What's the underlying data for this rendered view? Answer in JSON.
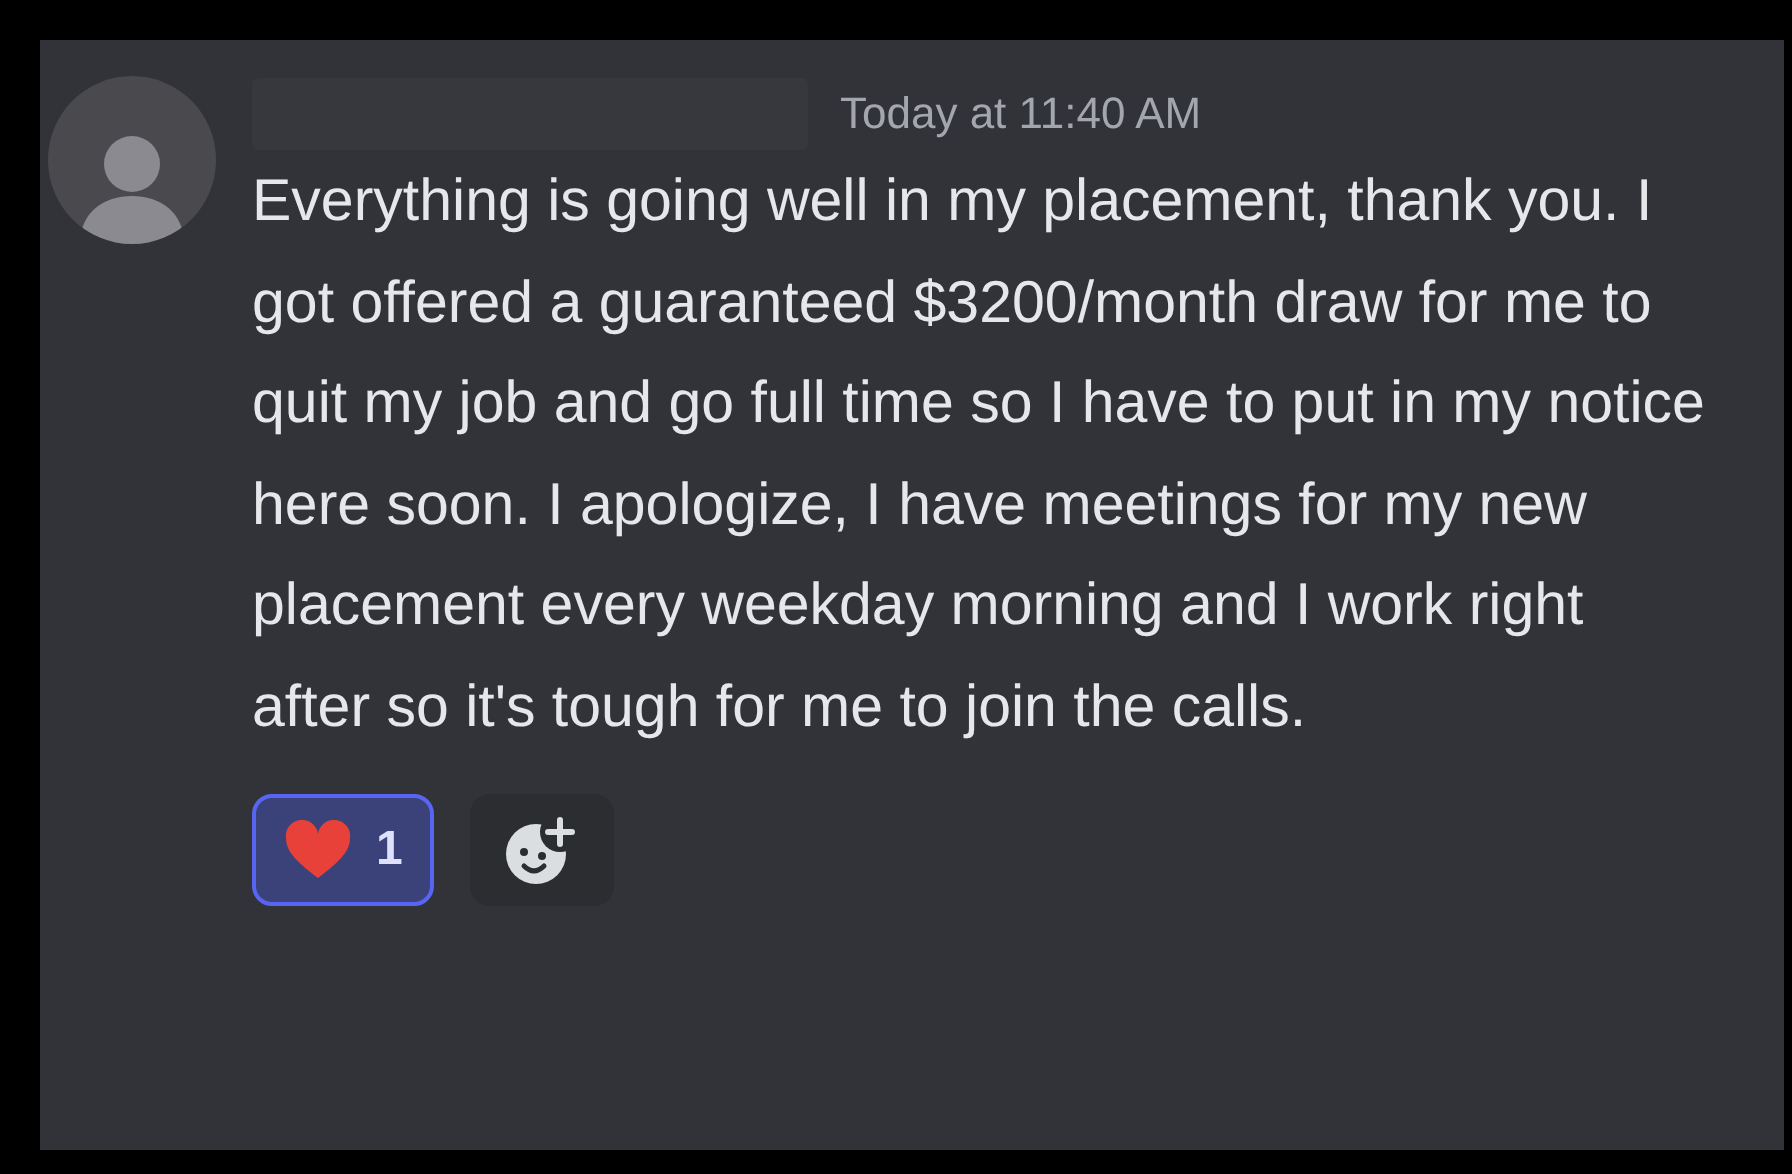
{
  "message": {
    "timestamp": "Today at 11:40 AM",
    "text": "Everything is going well in my placement, thank you. I got offered a guaranteed $3200/month draw for me to quit my job and go full time so I have to put in my notice here soon. I apologize, I have meetings for my new placement every weekday morning and I work right after so it's tough for me to join the calls.",
    "reactions": [
      {
        "kind": "heart",
        "count": "1",
        "selected": true
      }
    ]
  }
}
